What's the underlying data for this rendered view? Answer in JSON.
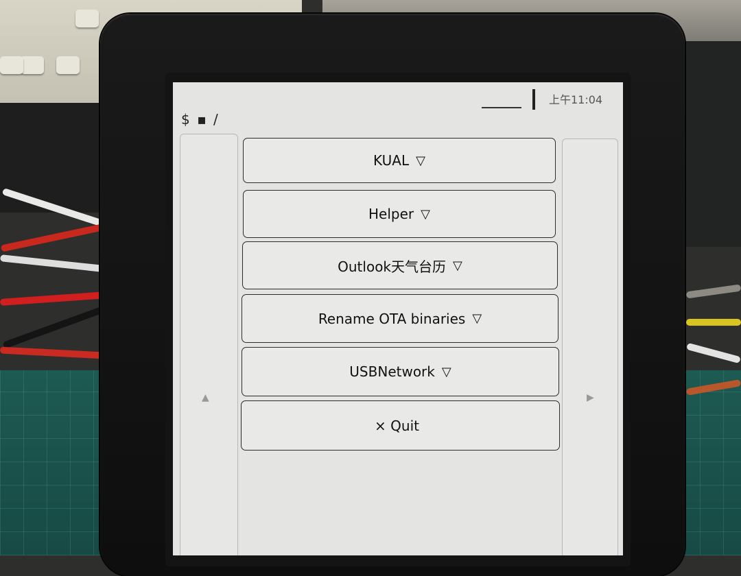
{
  "screen": {
    "clock": "上午11:04",
    "path": "$ ▪ /",
    "menu_items": [
      {
        "label": "KUAL",
        "marker": "▽"
      },
      {
        "label": "Helper",
        "marker": "▽"
      },
      {
        "label": "Outlook天气台历",
        "marker": "▽"
      },
      {
        "label": "Rename OTA binaries",
        "marker": "▽"
      },
      {
        "label": "USBNetwork",
        "marker": "▽"
      },
      {
        "label": "× Quit",
        "marker": ""
      }
    ],
    "nav": {
      "up_arrow": "▲",
      "next_arrow": "▶"
    }
  }
}
